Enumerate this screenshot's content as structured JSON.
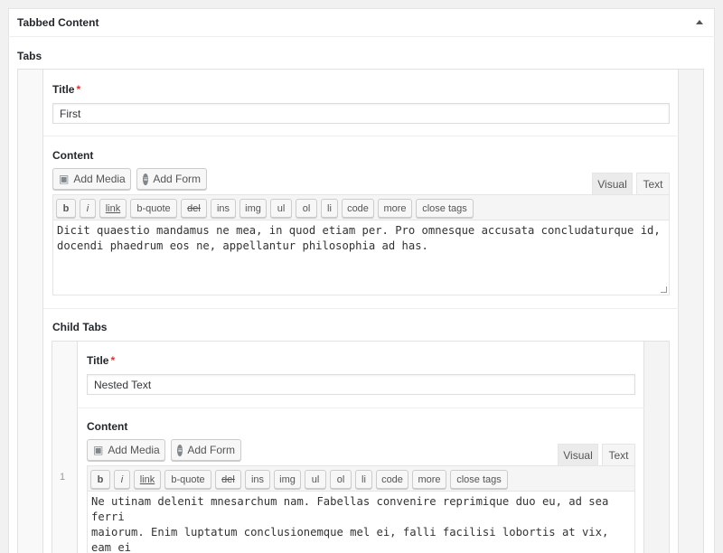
{
  "panel": {
    "title": "Tabbed Content"
  },
  "tabs_field": {
    "label": "Tabs"
  },
  "tab1": {
    "title_label": "Title",
    "required_mark": "*",
    "title_value": "First",
    "content_label": "Content",
    "add_media": "Add Media",
    "add_form": "Add Form",
    "mode_visual": "Visual",
    "mode_text": "Text",
    "quicktags": [
      "b",
      "i",
      "link",
      "b-quote",
      "del",
      "ins",
      "img",
      "ul",
      "ol",
      "li",
      "code",
      "more",
      "close tags"
    ],
    "content_value": "Dicit quaestio mandamus ne mea, in quod etiam per. Pro omnesque accusata concludaturque id,\ndocendi phaedrum eos ne, appellantur philosophia ad has."
  },
  "child_tabs": {
    "label": "Child Tabs",
    "row_index": "1",
    "title_label": "Title",
    "required_mark": "*",
    "title_value": "Nested Text",
    "content_label": "Content",
    "add_media": "Add Media",
    "add_form": "Add Form",
    "mode_visual": "Visual",
    "mode_text": "Text",
    "quicktags": [
      "b",
      "i",
      "link",
      "b-quote",
      "del",
      "ins",
      "img",
      "ul",
      "ol",
      "li",
      "code",
      "more",
      "close tags"
    ],
    "content_value": "Ne utinam delenit mnesarchum nam. Fabellas convenire reprimique duo eu, ad sea ferri\nmaiorum. Enim luptatum conclusionemque mel ei, falli facilisi lobortis at vix, eam ei\nillud accusamus suscipiantur. Dicit quaestio mandamus ne mea, in quod etiam per. Pro\nomnesque accusata concludaturque id, docendi phaedrum eos ne, appellantur philosophia"
  }
}
